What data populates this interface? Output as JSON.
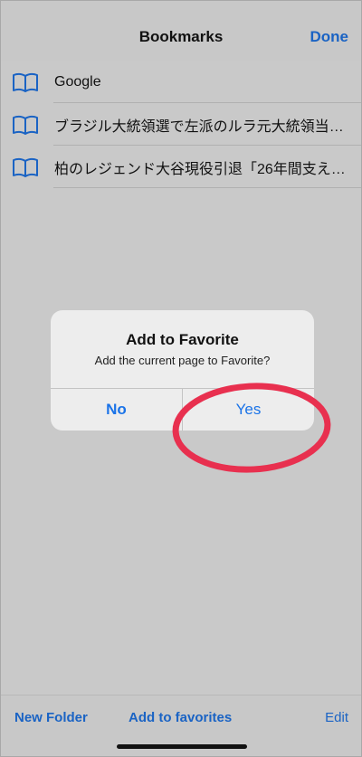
{
  "nav": {
    "title": "Bookmarks",
    "done_label": "Done"
  },
  "bookmarks": [
    {
      "icon": "book-icon",
      "label": "Google"
    },
    {
      "icon": "book-icon",
      "label": "ブラジル大統領選で左派のルラ元大統領当選…"
    },
    {
      "icon": "book-icon",
      "label": "柏のレジェンド大谷現役引退「26年間支え…"
    }
  ],
  "dialog": {
    "title": "Add to Favorite",
    "message": "Add the current page to Favorite?",
    "no_label": "No",
    "yes_label": "Yes"
  },
  "toolbar": {
    "new_folder_label": "New Folder",
    "add_favorites_label": "Add to favorites",
    "edit_label": "Edit"
  },
  "colors": {
    "accent": "#1a63c4",
    "highlight_circle": "#e8304f",
    "dim_background": "#c9c9c9"
  }
}
